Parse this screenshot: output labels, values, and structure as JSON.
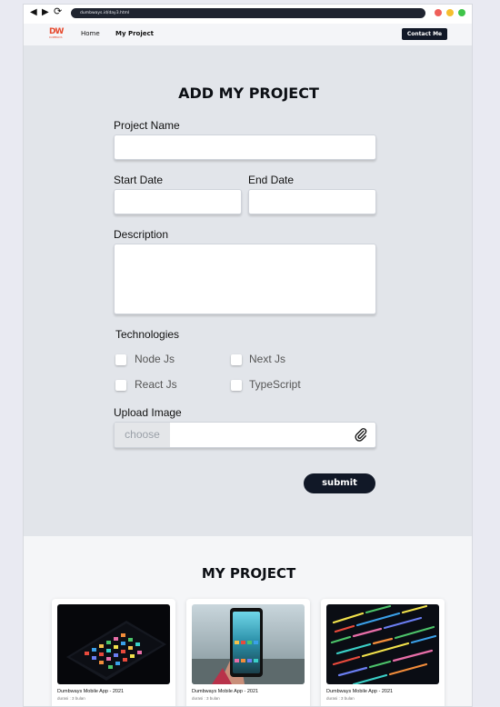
{
  "browser": {
    "url": "dumbways.id/day3.html",
    "back_icon": "back-arrow-icon",
    "forward_icon": "forward-arrow-icon",
    "reload_icon": "reload-icon",
    "window_dots": [
      "#ef5f59",
      "#f5be2f",
      "#3fc449"
    ]
  },
  "navbar": {
    "logo_text": "DW",
    "logo_sub": "DUMBWAYS",
    "links": [
      "Home",
      "My Project"
    ],
    "contact_label": "Contact Me"
  },
  "form": {
    "title": "ADD MY PROJECT",
    "project_name_label": "Project Name",
    "project_name_value": "",
    "start_date_label": "Start Date",
    "start_date_value": "",
    "end_date_label": "End Date",
    "end_date_value": "",
    "description_label": "Description",
    "description_value": "",
    "technologies_label": "Technologies",
    "technologies": [
      {
        "label": "Node Js",
        "checked": false
      },
      {
        "label": "Next Js",
        "checked": false
      },
      {
        "label": "React Js",
        "checked": false
      },
      {
        "label": "TypeScript",
        "checked": false
      }
    ],
    "upload_label": "Upload Image",
    "choose_label": "choose",
    "attach_icon": "paperclip-icon",
    "submit_label": "submit"
  },
  "projects": {
    "title": "MY PROJECT",
    "cards": [
      {
        "title": "Dumbways Mobile App - 2021",
        "subtitle": "durasi : 3 bulan",
        "image": "smartphone-apps-photo"
      },
      {
        "title": "Dumbways Mobile App - 2021",
        "subtitle": "durasi : 3 bulan",
        "image": "hand-holding-phone-photo"
      },
      {
        "title": "Dumbways Mobile App - 2021",
        "subtitle": "durasi : 3 bulan",
        "image": "code-screen-photo"
      }
    ]
  },
  "colors": {
    "accent_dark": "#111827",
    "brand_red": "#e6492d",
    "form_background": "#e2e5ea"
  }
}
